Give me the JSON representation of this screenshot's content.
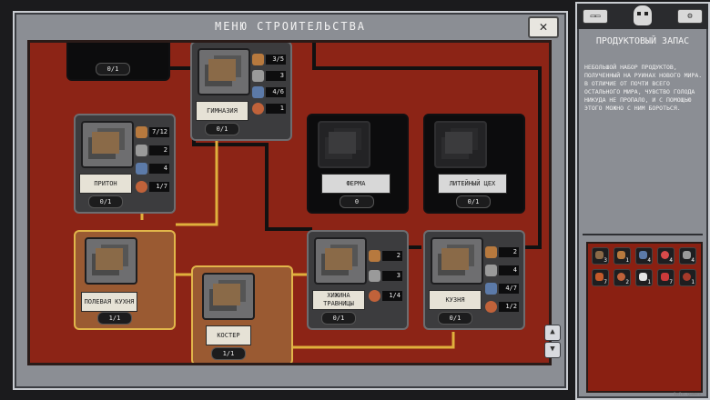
{
  "window": {
    "title": "МЕНЮ СТРОИТЕЛЬСТВА",
    "close_label": "✕",
    "scroll_up": "▲",
    "scroll_down": "▼"
  },
  "colors": {
    "board": "#8c2416",
    "link_dark": "#111111",
    "link_gold": "#e0b03c",
    "card": "#3c3c3e",
    "card_active": "#9a5a32"
  },
  "buildings": [
    {
      "id": "top-left",
      "label": "",
      "count": "0/1",
      "state": "dark",
      "resources": []
    },
    {
      "id": "gym",
      "label": "ГИМНАЗИЯ",
      "count": "0/1",
      "state": "normal",
      "resources": [
        {
          "icon": "planks-icon",
          "value": "3/5"
        },
        {
          "icon": "stone-icon",
          "value": "3"
        },
        {
          "icon": "metal-icon",
          "value": "4/6"
        },
        {
          "icon": "food-icon",
          "value": "1"
        }
      ]
    },
    {
      "id": "den",
      "label": "ПРИТОН",
      "count": "0/1",
      "state": "normal",
      "resources": [
        {
          "icon": "planks-icon",
          "value": "7/12"
        },
        {
          "icon": "stone-icon",
          "value": "2"
        },
        {
          "icon": "metal-icon",
          "value": "4"
        },
        {
          "icon": "food-icon",
          "value": "1/7"
        }
      ]
    },
    {
      "id": "farm",
      "label": "ФЕРМА",
      "count": "0",
      "state": "dark",
      "resources": []
    },
    {
      "id": "foundry",
      "label": "ЛИТЕЙНЫЙ ЦЕХ",
      "count": "0/1",
      "state": "dark",
      "resources": []
    },
    {
      "id": "field-kitchen",
      "label": "ПОЛЕВАЯ КУХНЯ",
      "count": "1/1",
      "state": "active",
      "resources": []
    },
    {
      "id": "campfire",
      "label": "КОСТЕР",
      "count": "1/1",
      "state": "active",
      "resources": []
    },
    {
      "id": "herbalist",
      "label": "ХИЖИНА ТРАВНИЦЫ",
      "count": "0/1",
      "state": "normal",
      "resources": [
        {
          "icon": "planks-icon",
          "value": "2"
        },
        {
          "icon": "stone-icon",
          "value": "3"
        },
        {
          "icon": "food-icon",
          "value": "1/4"
        }
      ]
    },
    {
      "id": "smithy",
      "label": "КУЗНЯ",
      "count": "0/1",
      "state": "normal",
      "resources": [
        {
          "icon": "planks-icon",
          "value": "2"
        },
        {
          "icon": "stone-icon",
          "value": "4"
        },
        {
          "icon": "metal-icon",
          "value": "4/7"
        },
        {
          "icon": "food-icon",
          "value": "1/2"
        }
      ]
    }
  ],
  "side": {
    "header_left": "▭▭",
    "header_right": "⚙",
    "title": "ПРОДУКТОВЫЙ ЗАПАС",
    "description": "НЕБОЛЬШОЙ НАБОР ПРОДУКТОВ, ПОЛУЧЕННЫЙ НА РУИНАХ НОВОГО МИРА. В ОТЛИЧИЕ ОТ ПОЧТИ ВСЕГО ОСТАЛЬНОГО МИРА, ЧУВСТВО ГОЛОДА НИКУДА НЕ ПРОПАЛО, И С ПОМОЩЬЮ ЭТОГО МОЖНО С НИМ БОРОТЬСЯ.",
    "inventory": [
      {
        "icon": "scrap-icon",
        "count": "3"
      },
      {
        "icon": "planks-icon",
        "count": "1"
      },
      {
        "icon": "metal-icon",
        "count": "4"
      },
      {
        "icon": "orb-icon",
        "count": "4"
      },
      {
        "icon": "gear-part-icon",
        "count": "4"
      },
      {
        "icon": "bundle-icon",
        "count": "7"
      },
      {
        "icon": "food-icon",
        "count": "2"
      },
      {
        "icon": "shard-icon",
        "count": "1"
      },
      {
        "icon": "flask-icon",
        "count": "7"
      },
      {
        "icon": "ration-icon",
        "count": "1"
      }
    ]
  },
  "watermark": "lolo.games"
}
